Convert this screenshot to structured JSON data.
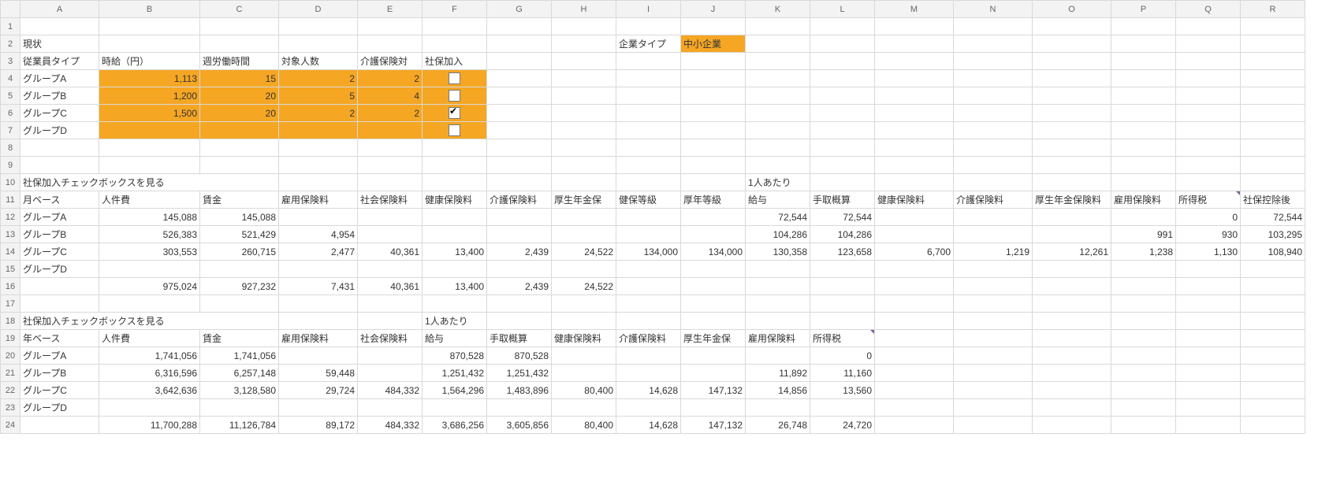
{
  "cols": [
    "A",
    "B",
    "C",
    "D",
    "E",
    "F",
    "G",
    "H",
    "I",
    "J",
    "K",
    "L",
    "M",
    "N",
    "O",
    "P",
    "Q",
    "R"
  ],
  "row2": {
    "A": "現状",
    "I": "企業タイプ",
    "J": "中小企業"
  },
  "row3": {
    "A": "従業員タイプ",
    "B": "時給（円）",
    "C": "週労働時間",
    "D": "対象人数",
    "E": "介護保険対",
    "F": "社保加入"
  },
  "groups": {
    "r4": {
      "A": "グループA",
      "B": "1,113",
      "C": "15",
      "D": "2",
      "E": "2",
      "chk": false
    },
    "r5": {
      "A": "グループB",
      "B": "1,200",
      "C": "20",
      "D": "5",
      "E": "4",
      "chk": false
    },
    "r6": {
      "A": "グループC",
      "B": "1,500",
      "C": "20",
      "D": "2",
      "E": "2",
      "chk": true
    },
    "r7": {
      "A": "グループD",
      "B": "",
      "C": "",
      "D": "",
      "E": "",
      "chk": false
    }
  },
  "row10": {
    "A": "社保加入チェックボックスを見る",
    "K": "1人あたり"
  },
  "row11": {
    "A": "月ベース",
    "B": "人件費",
    "C": "賃金",
    "D": "雇用保険料",
    "E": "社会保険料",
    "F": "健康保険料",
    "G": "介護保険料",
    "H": "厚生年金保",
    "I": "健保等級",
    "J": "厚年等級",
    "K": "給与",
    "L": "手取概算",
    "M": "健康保険料",
    "N": "介護保険料",
    "O": "厚生年金保険料",
    "P": "雇用保険料",
    "Q": "所得税",
    "R": "社保控除後"
  },
  "row12": {
    "A": "グループA",
    "B": "145,088",
    "C": "145,088",
    "K": "72,544",
    "L": "72,544",
    "Q": "0",
    "R": "72,544"
  },
  "row13": {
    "A": "グループB",
    "B": "526,383",
    "C": "521,429",
    "D": "4,954",
    "K": "104,286",
    "L": "104,286",
    "P": "991",
    "Q": "930",
    "R": "103,295"
  },
  "row14": {
    "A": "グループC",
    "B": "303,553",
    "C": "260,715",
    "D": "2,477",
    "E": "40,361",
    "F": "13,400",
    "G": "2,439",
    "H": "24,522",
    "I": "134,000",
    "J": "134,000",
    "K": "130,358",
    "L": "123,658",
    "M": "6,700",
    "N": "1,219",
    "O": "12,261",
    "P": "1,238",
    "Q": "1,130",
    "R": "108,940"
  },
  "row15": {
    "A": "グループD"
  },
  "row16": {
    "B": "975,024",
    "C": "927,232",
    "D": "7,431",
    "E": "40,361",
    "F": "13,400",
    "G": "2,439",
    "H": "24,522"
  },
  "row18": {
    "A": "社保加入チェックボックスを見る",
    "F": "1人あたり"
  },
  "row19": {
    "A": "年ベース",
    "B": "人件費",
    "C": "賃金",
    "D": "雇用保険料",
    "E": "社会保険料",
    "F": "給与",
    "G": "手取概算",
    "H": "健康保険料",
    "I": "介護保険料",
    "J": "厚生年金保",
    "K": "雇用保険料",
    "L": "所得税"
  },
  "row20": {
    "A": "グループA",
    "B": "1,741,056",
    "C": "1,741,056",
    "F": "870,528",
    "G": "870,528",
    "L": "0"
  },
  "row21": {
    "A": "グループB",
    "B": "6,316,596",
    "C": "6,257,148",
    "D": "59,448",
    "F": "1,251,432",
    "G": "1,251,432",
    "K": "11,892",
    "L": "11,160"
  },
  "row22": {
    "A": "グループC",
    "B": "3,642,636",
    "C": "3,128,580",
    "D": "29,724",
    "E": "484,332",
    "F": "1,564,296",
    "G": "1,483,896",
    "H": "80,400",
    "I": "14,628",
    "J": "147,132",
    "K": "14,856",
    "L": "13,560"
  },
  "row23": {
    "A": "グループD"
  },
  "row24": {
    "B": "11,700,288",
    "C": "11,126,784",
    "D": "89,172",
    "E": "484,332",
    "F": "3,686,256",
    "G": "3,605,856",
    "H": "80,400",
    "I": "14,628",
    "J": "147,132",
    "K": "26,748",
    "L": "24,720"
  },
  "widths": {
    "rowhead": 25,
    "A": 100,
    "B": 128,
    "C": 100,
    "D": 100,
    "E": 82,
    "F": 82,
    "G": 82,
    "H": 82,
    "I": 82,
    "J": 82,
    "K": 82,
    "L": 82,
    "M": 100,
    "N": 100,
    "O": 100,
    "P": 82,
    "Q": 82,
    "R": 82
  }
}
